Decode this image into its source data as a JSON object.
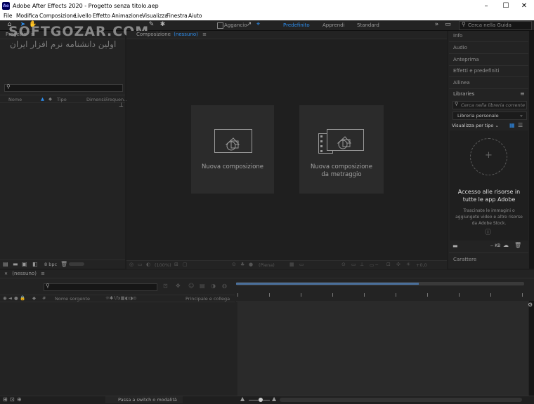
{
  "window": {
    "title": "Adobe After Effects 2020 - Progetto senza titolo.aep",
    "app_icon": "Ae"
  },
  "menu": [
    "File",
    "Modifica",
    "Composizione",
    "Livello",
    "Effetto",
    "Animazione",
    "Visualizza",
    "Finestra",
    "Aiuto"
  ],
  "toolbar": {
    "snap_label": "Aggancio",
    "workspaces": [
      "Predefinito",
      "Apprendi",
      "Standard"
    ],
    "active_workspace_color": "#2d8ceb",
    "search_placeholder": "Cerca nella Guida"
  },
  "watermark": {
    "line1": "SOFTGOZAR.COM",
    "line2": "اولین دانشنامه نرم افزار ایران"
  },
  "project_panel": {
    "title": "Progetto",
    "columns": [
      "Nome",
      "Tipo",
      "Dimensi..",
      "Frequen.."
    ],
    "bpc": "8 bpc"
  },
  "comp_panel": {
    "title": "Composizione",
    "comp_name": "(nessuno)",
    "new_comp_label": "Nuova composizione",
    "new_comp_footage_line1": "Nuova composizione",
    "new_comp_footage_line2": "da metraggio",
    "zoom": "(100%)",
    "quality": "(Piena)",
    "plus": "+0,0"
  },
  "right_panels": {
    "items": [
      "Info",
      "Audio",
      "Anteprima",
      "Effetti e predefiniti",
      "Allinea"
    ],
    "libraries": {
      "title": "Libraries",
      "search_placeholder": "Cerca nella libreria corrente",
      "library_select": "Libreria personale",
      "view_by": "Visualizza per tipo",
      "heading_line1": "Accesso alle risorse in",
      "heading_line2": "tutte le app Adobe",
      "body_line1": "Trascinate le immagini o",
      "body_line2": "aggiungete video e altre risorse",
      "body_line3": "da Adobe Stock.",
      "kb": "-- KB"
    },
    "characters": "Carattere"
  },
  "timeline": {
    "tab": "(nessuno)",
    "col_source": "Nome sorgente",
    "col_parent": "Principale e collega",
    "footer": "Passa a switch o modalità",
    "work_area_color": "#4a6f9a"
  }
}
